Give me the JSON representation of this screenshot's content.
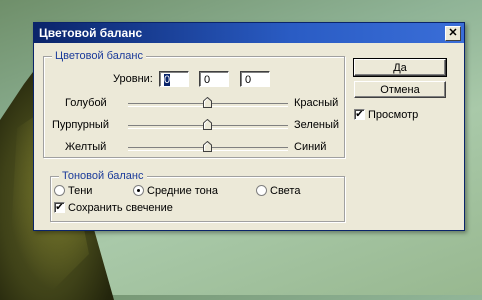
{
  "dialog": {
    "title": "Цветовой баланс",
    "close_icon": "close-icon"
  },
  "color_balance": {
    "group_label": "Цветовой баланс",
    "levels_label": "Уровни:",
    "levels": [
      "0",
      "0",
      "0"
    ],
    "sliders": [
      {
        "left": "Голубой",
        "right": "Красный",
        "value": 0
      },
      {
        "left": "Пурпурный",
        "right": "Зеленый",
        "value": 0
      },
      {
        "left": "Желтый",
        "right": "Синий",
        "value": 0
      }
    ]
  },
  "tone_balance": {
    "group_label": "Тоновой баланс",
    "options": [
      {
        "label": "Тени",
        "selected": false
      },
      {
        "label": "Средние тона",
        "selected": true
      },
      {
        "label": "Света",
        "selected": false
      }
    ],
    "preserve_luminosity": {
      "label": "Сохранить свечение",
      "checked": true
    }
  },
  "buttons": {
    "ok": "Да",
    "cancel": "Отмена"
  },
  "preview": {
    "label": "Просмотр",
    "checked": true
  },
  "glyphs": {
    "check": "✔",
    "close": "✕"
  }
}
